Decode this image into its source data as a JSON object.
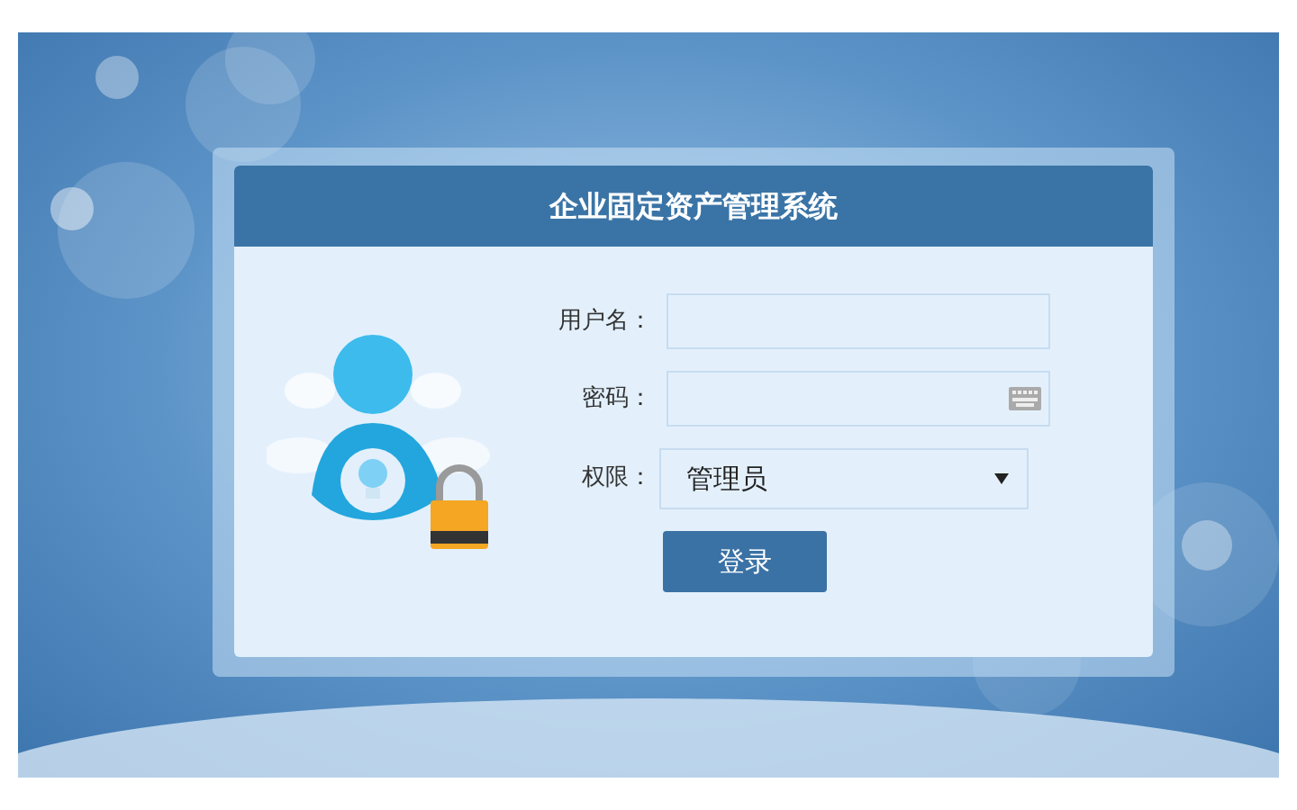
{
  "login_panel": {
    "title": "企业固定资产管理系统",
    "fields": [
      {
        "kind": "text",
        "label": "用户名："
      },
      {
        "kind": "password",
        "label": "密码："
      },
      {
        "kind": "select",
        "label": "权限：",
        "value": "管理员"
      }
    ],
    "submit": "登录"
  }
}
